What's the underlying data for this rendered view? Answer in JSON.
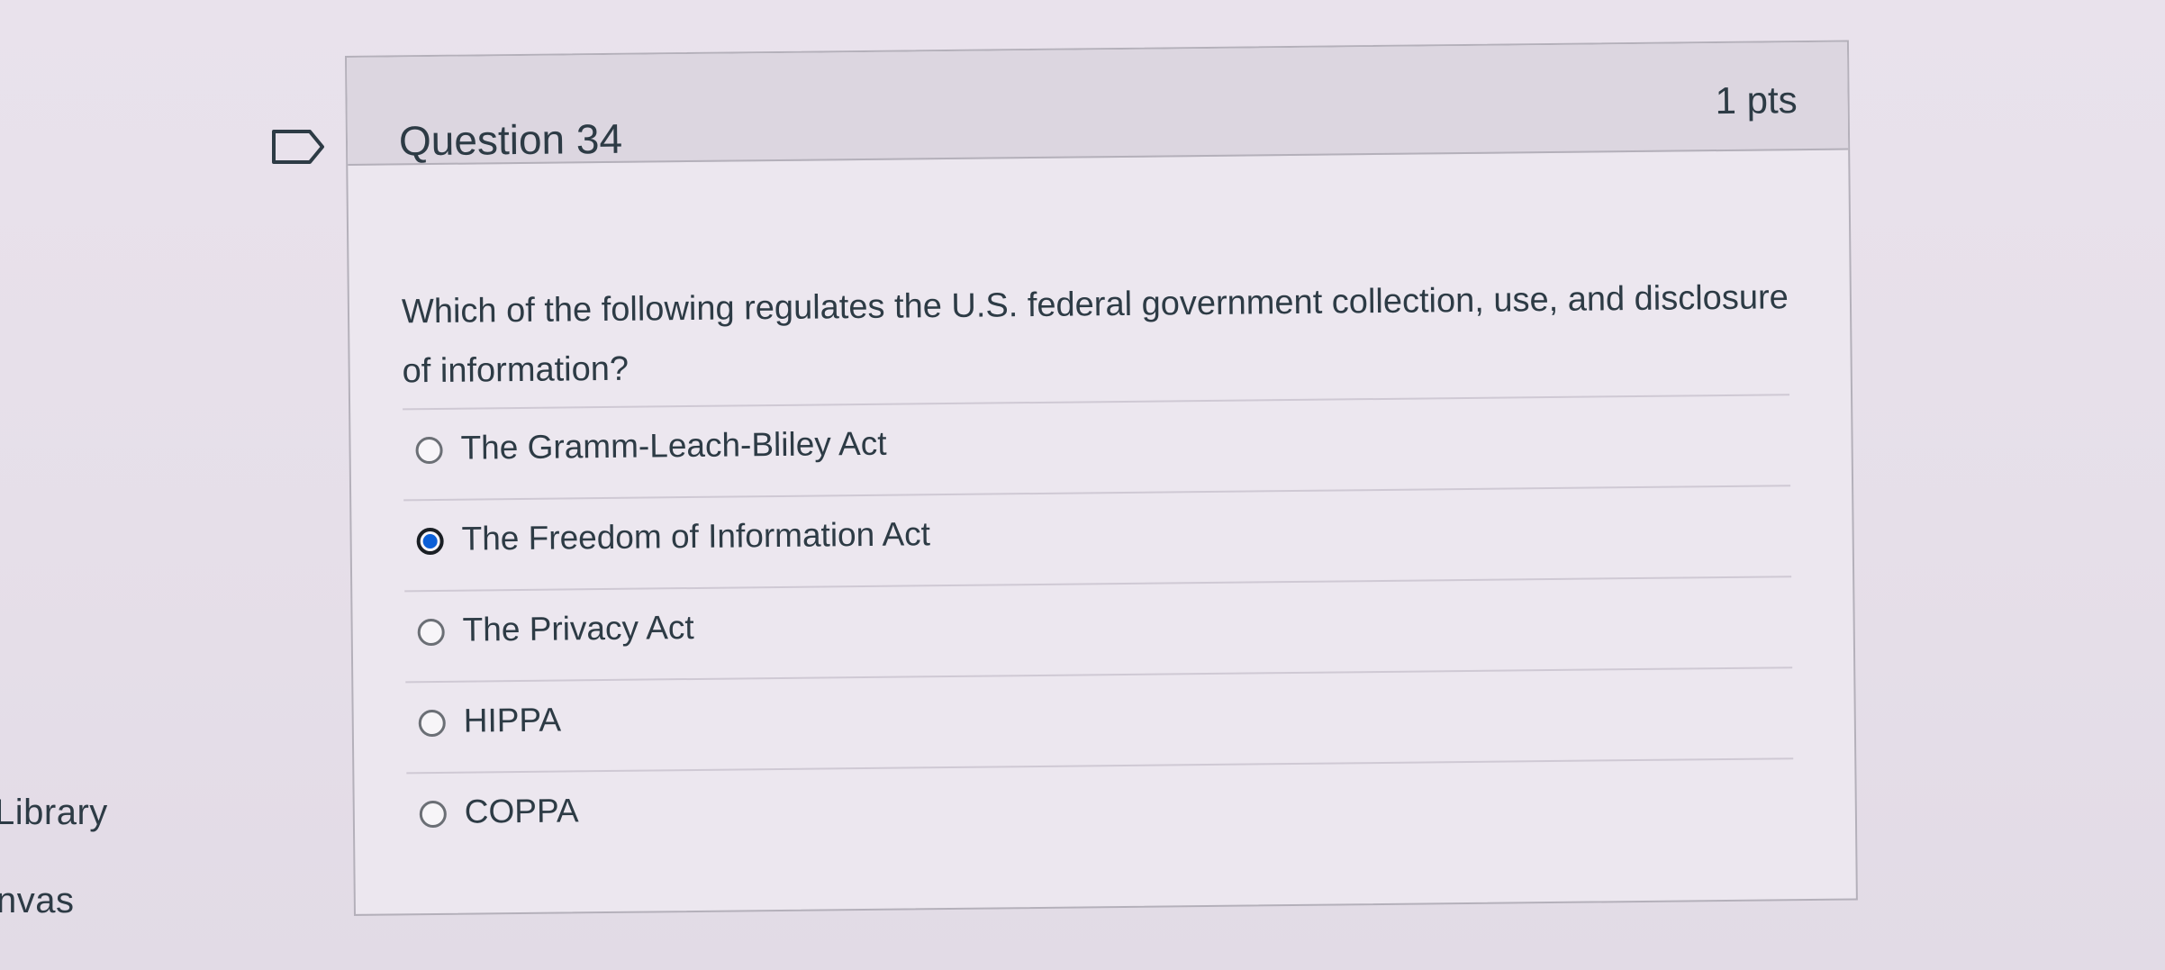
{
  "sidebar": {
    "library_label": "Library",
    "canvas_label": "nvas"
  },
  "question": {
    "title": "Question 34",
    "points": "1 pts",
    "text": "Which of the following regulates the U.S. federal government collection, use, and disclosure of information?",
    "answers": [
      {
        "label": "The Gramm-Leach-Bliley Act",
        "selected": false
      },
      {
        "label": "The Freedom of Information Act",
        "selected": true
      },
      {
        "label": "The Privacy Act",
        "selected": false
      },
      {
        "label": "HIPPA",
        "selected": false
      },
      {
        "label": "COPPA",
        "selected": false
      }
    ]
  },
  "colors": {
    "accent": "#0b5fd6",
    "text": "#2d3b45",
    "header_bg": "#dcd6e0",
    "border": "#b4b0ba"
  },
  "icons": {
    "flag": "flag-question-icon"
  }
}
